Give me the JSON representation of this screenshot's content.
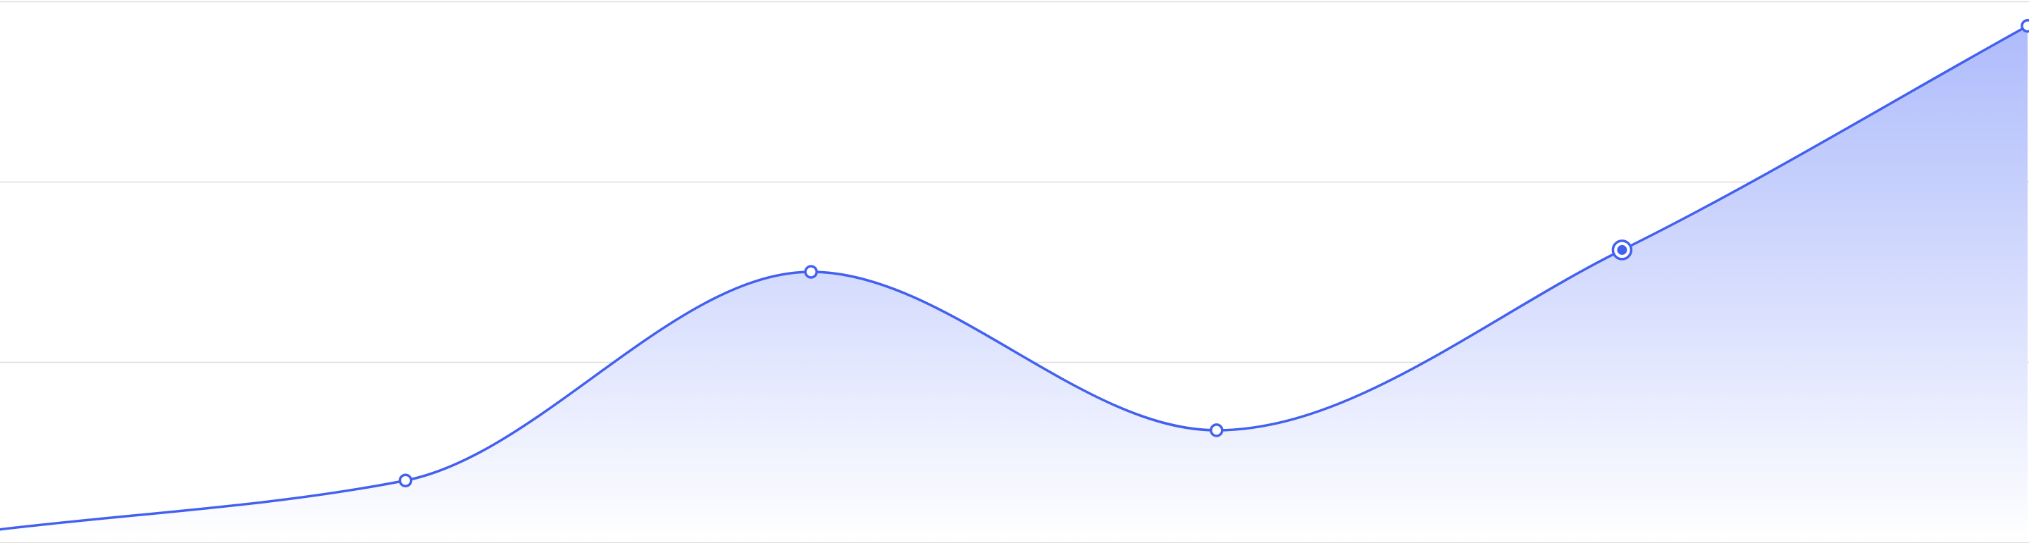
{
  "chart_data": {
    "type": "area",
    "x": [
      0,
      1,
      2,
      3,
      4,
      5
    ],
    "values": [
      10,
      48,
      210,
      87,
      227,
      401
    ],
    "ylim": [
      0,
      420
    ],
    "grid": true,
    "highlighted_index": 4
  },
  "colors": {
    "line": "#4361ee",
    "fill_top": "#aab8fb",
    "fill_bottom": "#ffffff",
    "grid": "#dedede",
    "point_fill": "#ffffff"
  }
}
